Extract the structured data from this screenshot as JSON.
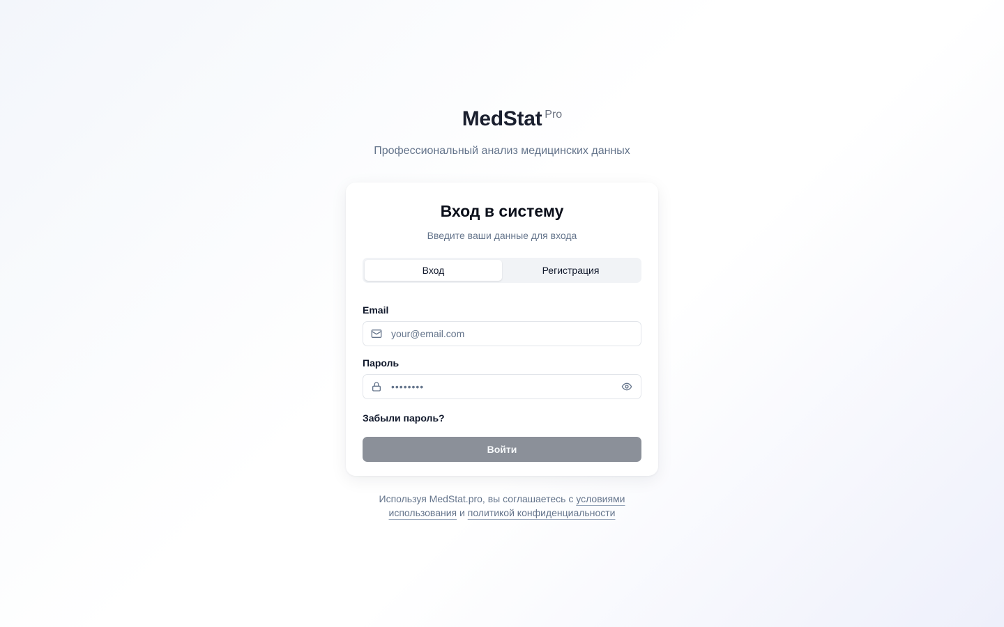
{
  "brand": {
    "name": "MedStat",
    "suffix": "Pro",
    "tagline": "Профессиональный анализ медицинских данных"
  },
  "card": {
    "title": "Вход в систему",
    "subtitle": "Введите ваши данные для входа"
  },
  "tabs": [
    {
      "label": "Вход",
      "active": true
    },
    {
      "label": "Регистрация",
      "active": false
    }
  ],
  "form": {
    "email": {
      "label": "Email",
      "value": "",
      "placeholder": "your@email.com",
      "icon": "mail-icon"
    },
    "password": {
      "label": "Пароль",
      "masked_value": "••••••••",
      "icon": "lock-icon",
      "toggle_icon": "eye-icon"
    },
    "forgot_label": "Забыли пароль?",
    "submit_label": "Войти"
  },
  "terms": {
    "prefix": "Используя MedStat.pro, вы соглашаетесь с",
    "terms_link": "условиями использования",
    "conjunction": "и",
    "privacy_link": "политикой конфиденциальности"
  },
  "colors": {
    "submit_bg": "#8b9099",
    "muted_text": "#64748b",
    "primary_text": "#0f172a"
  }
}
